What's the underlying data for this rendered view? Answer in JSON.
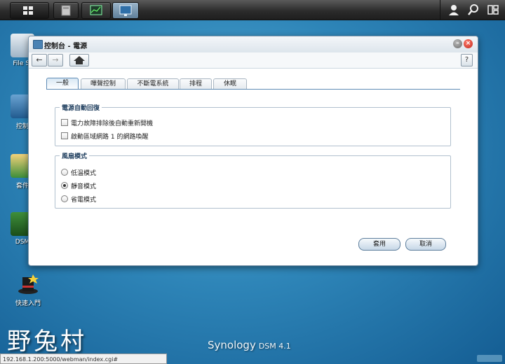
{
  "taskbar": {
    "user_icon": "user-icon",
    "search_icon": "search-icon",
    "widgets_icon": "widgets-icon"
  },
  "desktop": {
    "icons": [
      {
        "label": "File St"
      },
      {
        "label": "控制"
      },
      {
        "label": "套件"
      },
      {
        "label": "DSM"
      },
      {
        "label": "快速入門"
      }
    ]
  },
  "window": {
    "title": "控制台 - 電源",
    "help_label": "?"
  },
  "tabs": [
    "一般",
    "嗶聲控制",
    "不斷電系統",
    "排程",
    "休眠"
  ],
  "power_recovery": {
    "legend": "電源自動回復",
    "options": [
      {
        "label": "電力故障排除後自動重新開機",
        "checked": false
      },
      {
        "label": "啟動區域網路 1 的網路喚醒",
        "checked": false
      }
    ]
  },
  "fan_mode": {
    "legend": "風扇模式",
    "options": [
      {
        "label": "低溫模式",
        "selected": false
      },
      {
        "label": "靜音模式",
        "selected": true
      },
      {
        "label": "省電模式",
        "selected": false
      }
    ]
  },
  "buttons": {
    "apply": "套用",
    "cancel": "取消"
  },
  "watermark": "野兔村",
  "brand": {
    "name": "Synology",
    "version": "DSM 4.1"
  },
  "status_url": "192.168.1.200:5000/webman/index.cgi#"
}
